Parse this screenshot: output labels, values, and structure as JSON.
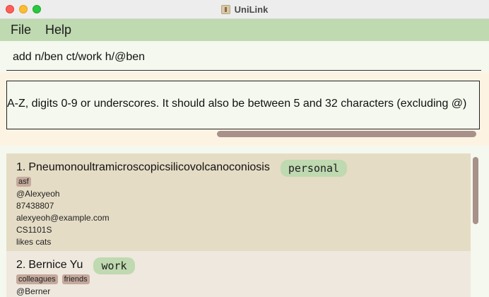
{
  "window": {
    "title": "UniLink",
    "icon": "app-book-icon"
  },
  "menu": {
    "items": [
      "File",
      "Help"
    ]
  },
  "command": {
    "value": "add n/ben ct/work h/@ben"
  },
  "result": {
    "text": "A-Z, digits 0-9 or underscores. It should also be between 5 and 32 characters (excluding @)"
  },
  "persons": [
    {
      "index": "1.",
      "name": "Pneumonoultramicroscopicsilicovolcanoconiosis",
      "contact_type": "personal",
      "tags": [
        "asf"
      ],
      "handle": "@Alexyeoh",
      "phone": "87438807",
      "email": "alexyeoh@example.com",
      "module": "CS1101S",
      "remark": "likes cats"
    },
    {
      "index": "2.",
      "name": "Bernice Yu",
      "contact_type": "work",
      "tags": [
        "colleagues",
        "friends"
      ],
      "handle": "@Berner"
    }
  ],
  "colors": {
    "menubar": "#bfd9b0",
    "pill": "#bfd9b0",
    "tag": "#c4a99c",
    "card_selected": "#e5dcc5",
    "card": "#efe8de",
    "scrollbar": "#a8918a"
  }
}
